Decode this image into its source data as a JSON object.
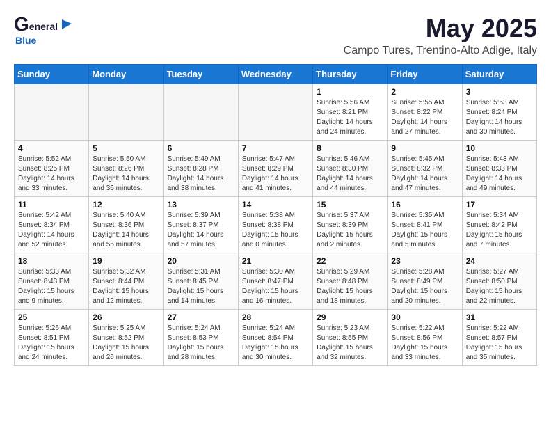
{
  "header": {
    "logo_general": "General",
    "logo_blue": "Blue",
    "title": "May 2025",
    "subtitle": "Campo Tures, Trentino-Alto Adige, Italy"
  },
  "days_of_week": [
    "Sunday",
    "Monday",
    "Tuesday",
    "Wednesday",
    "Thursday",
    "Friday",
    "Saturday"
  ],
  "weeks": [
    [
      {
        "day": "",
        "info": ""
      },
      {
        "day": "",
        "info": ""
      },
      {
        "day": "",
        "info": ""
      },
      {
        "day": "",
        "info": ""
      },
      {
        "day": "1",
        "info": "Sunrise: 5:56 AM\nSunset: 8:21 PM\nDaylight: 14 hours\nand 24 minutes."
      },
      {
        "day": "2",
        "info": "Sunrise: 5:55 AM\nSunset: 8:22 PM\nDaylight: 14 hours\nand 27 minutes."
      },
      {
        "day": "3",
        "info": "Sunrise: 5:53 AM\nSunset: 8:24 PM\nDaylight: 14 hours\nand 30 minutes."
      }
    ],
    [
      {
        "day": "4",
        "info": "Sunrise: 5:52 AM\nSunset: 8:25 PM\nDaylight: 14 hours\nand 33 minutes."
      },
      {
        "day": "5",
        "info": "Sunrise: 5:50 AM\nSunset: 8:26 PM\nDaylight: 14 hours\nand 36 minutes."
      },
      {
        "day": "6",
        "info": "Sunrise: 5:49 AM\nSunset: 8:28 PM\nDaylight: 14 hours\nand 38 minutes."
      },
      {
        "day": "7",
        "info": "Sunrise: 5:47 AM\nSunset: 8:29 PM\nDaylight: 14 hours\nand 41 minutes."
      },
      {
        "day": "8",
        "info": "Sunrise: 5:46 AM\nSunset: 8:30 PM\nDaylight: 14 hours\nand 44 minutes."
      },
      {
        "day": "9",
        "info": "Sunrise: 5:45 AM\nSunset: 8:32 PM\nDaylight: 14 hours\nand 47 minutes."
      },
      {
        "day": "10",
        "info": "Sunrise: 5:43 AM\nSunset: 8:33 PM\nDaylight: 14 hours\nand 49 minutes."
      }
    ],
    [
      {
        "day": "11",
        "info": "Sunrise: 5:42 AM\nSunset: 8:34 PM\nDaylight: 14 hours\nand 52 minutes."
      },
      {
        "day": "12",
        "info": "Sunrise: 5:40 AM\nSunset: 8:36 PM\nDaylight: 14 hours\nand 55 minutes."
      },
      {
        "day": "13",
        "info": "Sunrise: 5:39 AM\nSunset: 8:37 PM\nDaylight: 14 hours\nand 57 minutes."
      },
      {
        "day": "14",
        "info": "Sunrise: 5:38 AM\nSunset: 8:38 PM\nDaylight: 15 hours\nand 0 minutes."
      },
      {
        "day": "15",
        "info": "Sunrise: 5:37 AM\nSunset: 8:39 PM\nDaylight: 15 hours\nand 2 minutes."
      },
      {
        "day": "16",
        "info": "Sunrise: 5:35 AM\nSunset: 8:41 PM\nDaylight: 15 hours\nand 5 minutes."
      },
      {
        "day": "17",
        "info": "Sunrise: 5:34 AM\nSunset: 8:42 PM\nDaylight: 15 hours\nand 7 minutes."
      }
    ],
    [
      {
        "day": "18",
        "info": "Sunrise: 5:33 AM\nSunset: 8:43 PM\nDaylight: 15 hours\nand 9 minutes."
      },
      {
        "day": "19",
        "info": "Sunrise: 5:32 AM\nSunset: 8:44 PM\nDaylight: 15 hours\nand 12 minutes."
      },
      {
        "day": "20",
        "info": "Sunrise: 5:31 AM\nSunset: 8:45 PM\nDaylight: 15 hours\nand 14 minutes."
      },
      {
        "day": "21",
        "info": "Sunrise: 5:30 AM\nSunset: 8:47 PM\nDaylight: 15 hours\nand 16 minutes."
      },
      {
        "day": "22",
        "info": "Sunrise: 5:29 AM\nSunset: 8:48 PM\nDaylight: 15 hours\nand 18 minutes."
      },
      {
        "day": "23",
        "info": "Sunrise: 5:28 AM\nSunset: 8:49 PM\nDaylight: 15 hours\nand 20 minutes."
      },
      {
        "day": "24",
        "info": "Sunrise: 5:27 AM\nSunset: 8:50 PM\nDaylight: 15 hours\nand 22 minutes."
      }
    ],
    [
      {
        "day": "25",
        "info": "Sunrise: 5:26 AM\nSunset: 8:51 PM\nDaylight: 15 hours\nand 24 minutes."
      },
      {
        "day": "26",
        "info": "Sunrise: 5:25 AM\nSunset: 8:52 PM\nDaylight: 15 hours\nand 26 minutes."
      },
      {
        "day": "27",
        "info": "Sunrise: 5:24 AM\nSunset: 8:53 PM\nDaylight: 15 hours\nand 28 minutes."
      },
      {
        "day": "28",
        "info": "Sunrise: 5:24 AM\nSunset: 8:54 PM\nDaylight: 15 hours\nand 30 minutes."
      },
      {
        "day": "29",
        "info": "Sunrise: 5:23 AM\nSunset: 8:55 PM\nDaylight: 15 hours\nand 32 minutes."
      },
      {
        "day": "30",
        "info": "Sunrise: 5:22 AM\nSunset: 8:56 PM\nDaylight: 15 hours\nand 33 minutes."
      },
      {
        "day": "31",
        "info": "Sunrise: 5:22 AM\nSunset: 8:57 PM\nDaylight: 15 hours\nand 35 minutes."
      }
    ]
  ]
}
